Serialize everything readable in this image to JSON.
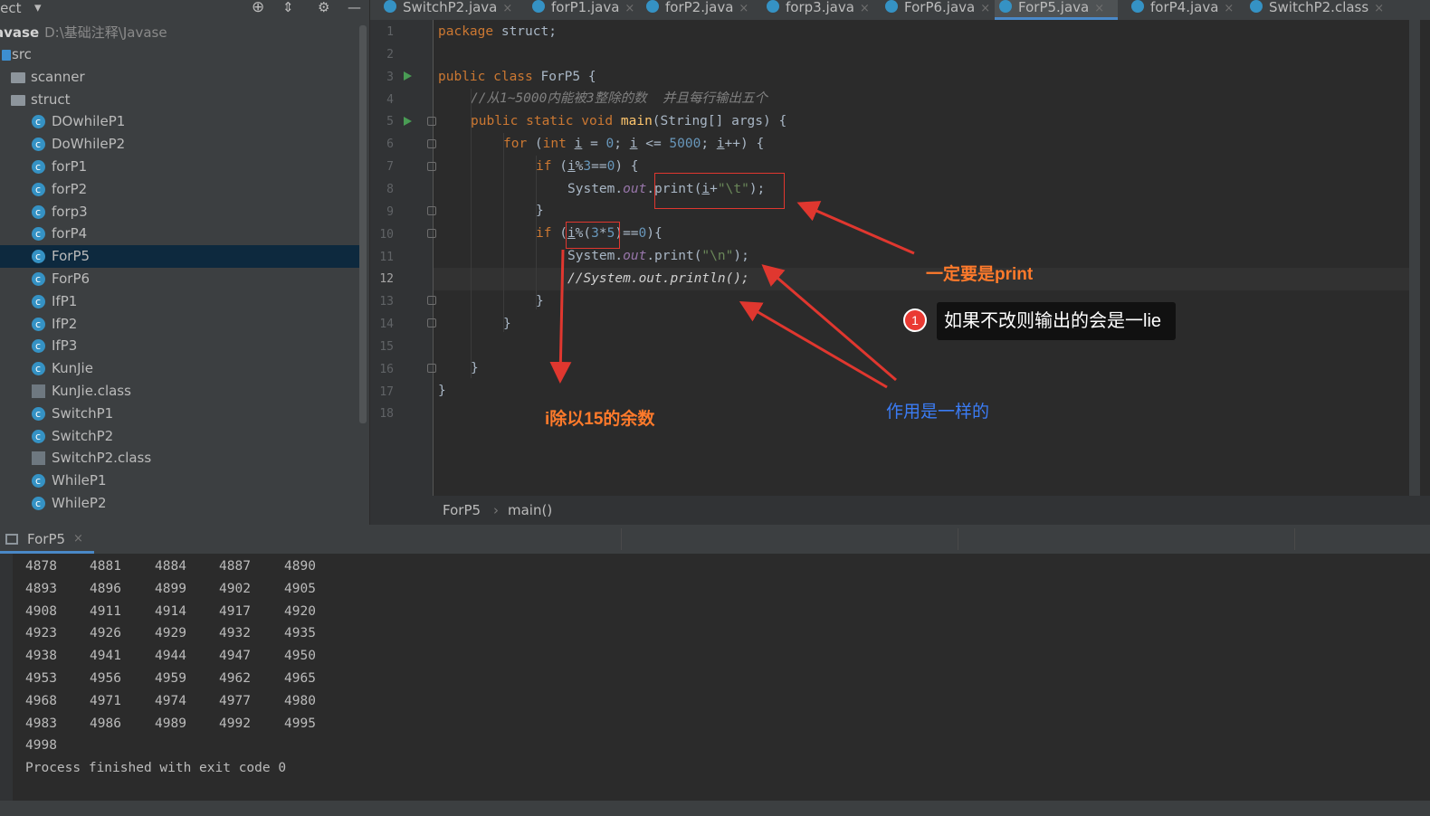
{
  "sidebar": {
    "header_title": "ject",
    "project_name": "avase",
    "project_path": "D:\\基础注释\\Javase",
    "items": [
      {
        "label": "src",
        "type": "folder-src"
      },
      {
        "label": "scanner",
        "type": "folder"
      },
      {
        "label": "struct",
        "type": "folder"
      },
      {
        "label": "DOwhileP1",
        "type": "class"
      },
      {
        "label": "DoWhileP2",
        "type": "class"
      },
      {
        "label": "forP1",
        "type": "class"
      },
      {
        "label": "forP2",
        "type": "class"
      },
      {
        "label": "forp3",
        "type": "class"
      },
      {
        "label": "forP4",
        "type": "class"
      },
      {
        "label": "ForP5",
        "type": "class",
        "selected": true
      },
      {
        "label": "ForP6",
        "type": "class"
      },
      {
        "label": "IfP1",
        "type": "class"
      },
      {
        "label": "IfP2",
        "type": "class"
      },
      {
        "label": "IfP3",
        "type": "class"
      },
      {
        "label": "KunJie",
        "type": "class"
      },
      {
        "label": "KunJie.class",
        "type": "binary"
      },
      {
        "label": "SwitchP1",
        "type": "class"
      },
      {
        "label": "SwitchP2",
        "type": "class"
      },
      {
        "label": "SwitchP2.class",
        "type": "binary"
      },
      {
        "label": "WhileP1",
        "type": "class"
      },
      {
        "label": "WhileP2",
        "type": "class"
      }
    ]
  },
  "tabs": [
    {
      "label": "SwitchP2.java"
    },
    {
      "label": "forP1.java"
    },
    {
      "label": "forP2.java"
    },
    {
      "label": "forp3.java"
    },
    {
      "label": "ForP6.java"
    },
    {
      "label": "ForP5.java",
      "active": true
    },
    {
      "label": "forP4.java"
    },
    {
      "label": "SwitchP2.class"
    }
  ],
  "tab_close_glyph": "×",
  "line_numbers": [
    "1",
    "2",
    "3",
    "4",
    "5",
    "6",
    "7",
    "8",
    "9",
    "10",
    "11",
    "12",
    "13",
    "14",
    "15",
    "16",
    "17",
    "18"
  ],
  "code": {
    "l1_kw": "package",
    "l1_rest": " struct;",
    "l3_kw": "public class",
    "l3_rest": " ForP5 {",
    "l4_comment": "//从1~5000内能被3整除的数  并且每行输出五个",
    "l5_kw": "public static void",
    "l5_fn": "main",
    "l5_rest": "(String[] args) {",
    "l6_for": "for",
    "l6_a": " (",
    "l6_int": "int",
    "l6_b": " ",
    "l6_i1": "i",
    "l6_c": " = ",
    "l6_n0": "0",
    "l6_d": "; ",
    "l6_i2": "i",
    "l6_e": " <= ",
    "l6_n5000": "5000",
    "l6_f": "; ",
    "l6_i3": "i",
    "l6_g": "++) {",
    "l7_if": "if",
    "l7_a": " (",
    "l7_i": "i",
    "l7_b": "%",
    "l7_n3": "3",
    "l7_c": "==",
    "l7_n0": "0",
    "l7_d": ") {",
    "l8_a": "System.",
    "l8_out": "out",
    "l8_b": ".print(",
    "l8_i": "i",
    "l8_c": "+",
    "l8_str": "\"\\t\"",
    "l8_d": ");",
    "l9": "}",
    "l10_if": "if",
    "l10_a": " (",
    "l10_i": "i",
    "l10_b": "%(",
    "l10_n3": "3",
    "l10_c": "*",
    "l10_n5": "5",
    "l10_d": ")==",
    "l10_n0": "0",
    "l10_e": "){",
    "l11_a": "System.",
    "l11_out": "out",
    "l11_b": ".print(",
    "l11_str": "\"\\n\"",
    "l11_c": ");",
    "l12_comment": "//System.out.println();",
    "l13": "}",
    "l14": "}",
    "l16": "}",
    "l17": "}"
  },
  "breadcrumb": {
    "items": [
      "ForP5",
      "main()"
    ],
    "separator": "›"
  },
  "run_tab": {
    "label": "ForP5"
  },
  "console_rows": [
    [
      "4878",
      "4881",
      "4884",
      "4887",
      "4890"
    ],
    [
      "4893",
      "4896",
      "4899",
      "4902",
      "4905"
    ],
    [
      "4908",
      "4911",
      "4914",
      "4917",
      "4920"
    ],
    [
      "4923",
      "4926",
      "4929",
      "4932",
      "4935"
    ],
    [
      "4938",
      "4941",
      "4944",
      "4947",
      "4950"
    ],
    [
      "4953",
      "4956",
      "4959",
      "4962",
      "4965"
    ],
    [
      "4968",
      "4971",
      "4974",
      "4977",
      "4980"
    ],
    [
      "4983",
      "4986",
      "4989",
      "4992",
      "4995"
    ],
    [
      "4998"
    ]
  ],
  "console_finish": "Process finished with exit code 0",
  "annotations": {
    "print_note": "一定要是print",
    "callout_badge": "1",
    "callout_text": "如果不改则输出的会是一lie",
    "same_effect": "作用是一样的",
    "remainder_note": "i除以15的余数"
  },
  "colors": {
    "accent": "#4a88c7",
    "annotation_red": "#e0372f",
    "annotation_orange": "#ff7a2b",
    "annotation_blue": "#3b7cf5"
  }
}
